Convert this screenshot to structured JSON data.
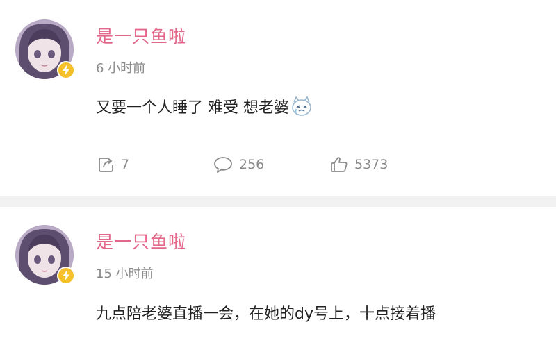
{
  "posts": [
    {
      "username": "是一只鱼啦",
      "time": "6 小时前",
      "text": "又要一个人睡了 难受 想老婆",
      "emoji": "crying-face-emoji",
      "actions": {
        "repost_icon": "repost-icon",
        "repost_count": "7",
        "comment_icon": "comment-icon",
        "comment_count": "256",
        "like_icon": "thumbs-up-icon",
        "like_count": "5373"
      }
    },
    {
      "username": "是一只鱼啦",
      "time": "15 小时前",
      "text": "九点陪老婆直播一会，在她的dy号上，十点接着播"
    }
  ],
  "colors": {
    "username": "#e26789",
    "meta": "#8a8a8a",
    "text": "#222222",
    "badge": "#f5c02a",
    "divider": "#f2f2f2"
  },
  "icons": {
    "badge": "lightning-badge-icon"
  }
}
